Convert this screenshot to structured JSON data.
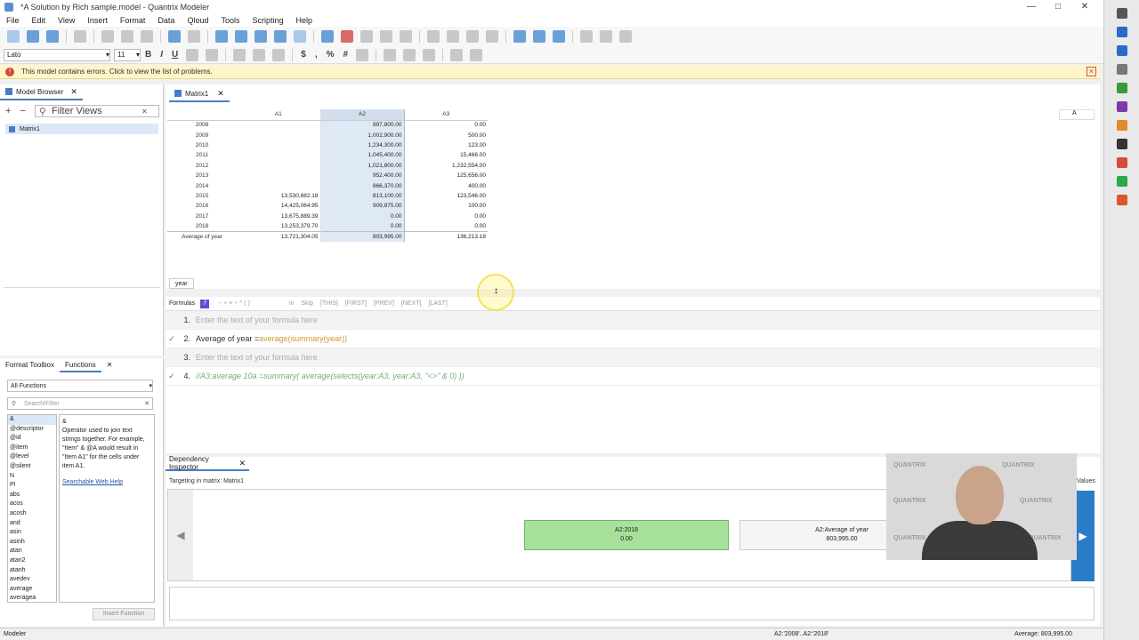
{
  "window": {
    "title": "*A Solution by Rich sample.model - Quantrix Modeler"
  },
  "menu": [
    "File",
    "Edit",
    "View",
    "Insert",
    "Format",
    "Data",
    "Qloud",
    "Tools",
    "Scripting",
    "Help"
  ],
  "format_bar": {
    "font": "Lato",
    "size": "11",
    "bold": "B",
    "italic": "I",
    "underline": "U"
  },
  "error_bar": {
    "message": "This model contains errors. Click to view the list of problems."
  },
  "model_browser": {
    "tab_label": "Model Browser",
    "filter_placeholder": "Filter Views",
    "items": [
      "Matrix1"
    ]
  },
  "functions_panel": {
    "tabs": [
      "Format Toolbox",
      "Functions"
    ],
    "category": "All Functions",
    "search_placeholder": "Search/Filter",
    "items": [
      "&",
      "@descriptor",
      "@id",
      "@item",
      "@level",
      "@silent",
      "N",
      "PI",
      "abs",
      "acos",
      "acosh",
      "and",
      "asin",
      "asinh",
      "atan",
      "atan2",
      "atanh",
      "avedev",
      "average",
      "averagea"
    ],
    "desc_title": "&",
    "desc_text": "Operator used to join text strings together.  For example, \"Item\" & @A would result in \"Item A1\" for the cells under item A1.",
    "help_link": "Searchable Web Help",
    "insert_button": "Insert Function"
  },
  "matrix": {
    "tab_label": "Matrix1",
    "columns": [
      "A1",
      "A2",
      "A3"
    ],
    "rows": [
      {
        "label": "2008",
        "a1": "",
        "a2": "997,800.00",
        "a3": "0.00"
      },
      {
        "label": "2009",
        "a1": "",
        "a2": "1,002,900.00",
        "a3": "500.00"
      },
      {
        "label": "2010",
        "a1": "",
        "a2": "1,234,300.00",
        "a3": "123.00"
      },
      {
        "label": "2011",
        "a1": "",
        "a2": "1,045,400.00",
        "a3": "15,466.00"
      },
      {
        "label": "2012",
        "a1": "",
        "a2": "1,021,800.00",
        "a3": "1,232,554.00"
      },
      {
        "label": "2013",
        "a1": "",
        "a2": "952,400.00",
        "a3": "125,656.00"
      },
      {
        "label": "2014",
        "a1": "",
        "a2": "866,370.00",
        "a3": "400.00"
      },
      {
        "label": "2015",
        "a1": "13,530,882.18",
        "a2": "813,100.00",
        "a3": "123,546.00"
      },
      {
        "label": "2016",
        "a1": "14,425,064.95",
        "a2": "909,875.00",
        "a3": "100.00"
      },
      {
        "label": "2017",
        "a1": "13,675,889.39",
        "a2": "0.00",
        "a3": "0.00"
      },
      {
        "label": "2018",
        "a1": "13,253,379.70",
        "a2": "0.00",
        "a3": "0.00"
      }
    ],
    "summary": {
      "label": "Average of year",
      "a1": "13,721,304.05",
      "a2": "803,995.00",
      "a3": "136,213.18"
    },
    "side_label": "A",
    "category_chip": "year"
  },
  "formulas": {
    "label": "Formulas",
    "keywords": [
      "in",
      "Skip",
      "[THIS]",
      "[FIRST]",
      "[PREV]",
      "[NEXT]",
      "[LAST]"
    ],
    "rows": [
      {
        "num": "1.",
        "placeholder": "Enter the text of your formula here"
      },
      {
        "num": "2.",
        "lhs": "Average of year = ",
        "fn": "average(summary(year))"
      },
      {
        "num": "3.",
        "placeholder": "Enter the text of your formula here"
      },
      {
        "num": "4.",
        "comment": "//A3:average 10a =summary( average(selects(year:A3, year:A3, \"<>\" & 0) ))"
      }
    ]
  },
  "dependency": {
    "tab_label": "Dependency Inspector",
    "target": "Targeting in matrix: Matrix1",
    "node_selected": {
      "name": "A2:2018",
      "value": "0.00"
    },
    "node_dependent": {
      "name": "A2:Average of year",
      "value": "803,995.00"
    },
    "values_label": "Values"
  },
  "status": {
    "left": "Modeler",
    "selection": "A2:'2008'..A2:'2018'",
    "average": "Average: 803,995.00"
  },
  "colors": {
    "accent": "#4a7cc4",
    "selected_node": "#a6e09a",
    "error_bg": "#fff5c9"
  }
}
